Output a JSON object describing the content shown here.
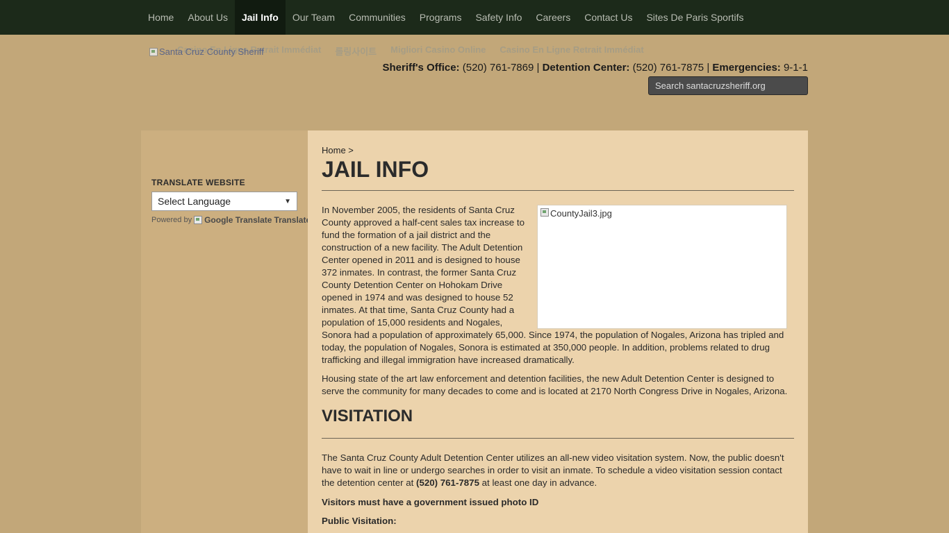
{
  "nav": [
    {
      "label": "Home",
      "active": false
    },
    {
      "label": "About Us",
      "active": false
    },
    {
      "label": "Jail Info",
      "active": true
    },
    {
      "label": "Our Team",
      "active": false
    },
    {
      "label": "Communities",
      "active": false
    },
    {
      "label": "Programs",
      "active": false
    },
    {
      "label": "Safety Info",
      "active": false
    },
    {
      "label": "Careers",
      "active": false
    },
    {
      "label": "Contact Us",
      "active": false
    },
    {
      "label": "Sites De Paris Sportifs",
      "active": false
    }
  ],
  "header": {
    "logo_alt": "Santa Cruz County Sheriff",
    "ad_links": [
      "Casino En Ligne Retrait Immédiat",
      "롤링사이트",
      "Migliori Casino Online",
      "Casino En Ligne Retrait Immédiat"
    ],
    "contact": {
      "sheriff_label": "Sheriff's Office:",
      "sheriff_phone": "(520) 761-7869",
      "detention_label": "Detention Center:",
      "detention_phone": "(520) 761-7875",
      "emergency_label": "Emergencies:",
      "emergency_phone": "9-1-1",
      "separator": "|"
    },
    "search_placeholder": "Search santacruzsheriff.org"
  },
  "sidebar": {
    "translate_title": "TRANSLATE WEBSITE",
    "language_select": "Select Language",
    "powered_by": "Powered by",
    "google_translate": "Google Translate",
    "translate": "Translate"
  },
  "main": {
    "breadcrumb": "Home >",
    "title": "JAIL INFO",
    "image_alt": "CountyJail3.jpg",
    "intro_para": "In November 2005, the residents of Santa Cruz County approved a half-cent sales tax increase to fund the formation of a jail district and the construction of a new facility. The Adult Detention Center opened in 2011 and is designed to house 372 inmates. In contrast, the former Santa Cruz County Detention Center on Hohokam Drive opened in 1974 and was designed to house 52 inmates. At that time, Santa Cruz County had a population of 15,000 residents and Nogales, Sonora had a population of approximately 65,000. Since 1974, the population of Nogales, Arizona has tripled and today, the population of Nogales, Sonora is estimated at 350,000 people. In addition, problems related to drug trafficking and illegal immigration have increased dramatically.",
    "housing_para": "Housing state of the art law enforcement and detention facilities, the new Adult Detention Center is designed to serve the community for many decades to come and is located at 2170 North Congress Drive in Nogales, Arizona.",
    "visitation_heading": "VISITATION",
    "visitation_para_start": "The Santa Cruz County Adult Detention Center utilizes an all-new video visitation system. Now, the public doesn't have to wait in line or undergo searches in order to visit an inmate. To schedule a video visitation session contact the detention center at ",
    "visitation_phone": "(520) 761-7875",
    "visitation_para_end": " at least one day in advance.",
    "photo_id_note": "Visitors must have a government issued photo ID",
    "public_visitation": "Public Visitation:"
  }
}
